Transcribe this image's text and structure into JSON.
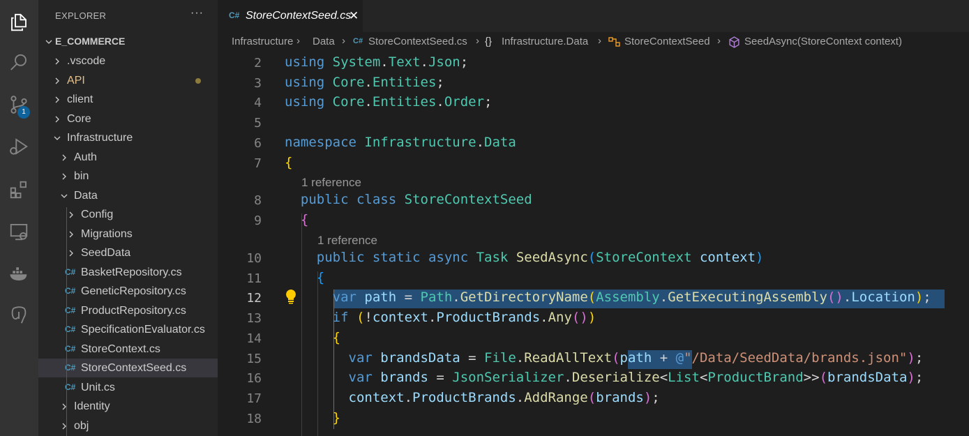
{
  "activity_bar": {
    "icons": [
      "explorer-icon",
      "search-icon",
      "source-control-icon",
      "run-debug-icon",
      "extensions-icon",
      "remote-explorer-icon",
      "docker-icon",
      "postgres-icon"
    ],
    "source_control_badge": "1"
  },
  "sidebar": {
    "title": "EXPLORER",
    "more": "···",
    "root": "E_COMMERCE",
    "items": [
      {
        "label": ".vscode"
      },
      {
        "label": "API"
      },
      {
        "label": "client"
      },
      {
        "label": "Core"
      },
      {
        "label": "Infrastructure"
      },
      {
        "label": "Auth"
      },
      {
        "label": "bin"
      },
      {
        "label": "Data"
      },
      {
        "label": "Config"
      },
      {
        "label": "Migrations"
      },
      {
        "label": "SeedData"
      },
      {
        "label": "BasketRepository.cs"
      },
      {
        "label": "GeneticRepository.cs"
      },
      {
        "label": "ProductRepository.cs"
      },
      {
        "label": "SpecificationEvaluator.cs"
      },
      {
        "label": "StoreContext.cs"
      },
      {
        "label": "StoreContextSeed.cs"
      },
      {
        "label": "Unit.cs"
      },
      {
        "label": "Identity"
      },
      {
        "label": "obj"
      }
    ],
    "cs_glyph": "C#"
  },
  "tab": {
    "label": "StoreContextSeed.cs",
    "close": "✕"
  },
  "breadcrumb": {
    "parts": [
      "Infrastructure",
      "Data",
      "StoreContextSeed.cs",
      "Infrastructure.Data",
      "StoreContextSeed",
      "SeedAsync(StoreContext context)"
    ],
    "braces": "{}"
  },
  "editor": {
    "line_numbers": [
      "2",
      "3",
      "4",
      "5",
      "6",
      "7",
      "8",
      "9",
      "10",
      "11",
      "12",
      "13",
      "14",
      "15",
      "16",
      "17",
      "18"
    ],
    "references": [
      "1 reference",
      "1 reference"
    ],
    "lines": [
      [
        [
          "using",
          "k"
        ],
        [
          " ",
          ""
        ],
        [
          "System",
          "t"
        ],
        [
          ".",
          ""
        ],
        [
          "Text",
          "t"
        ],
        [
          ".",
          ""
        ],
        [
          "Json",
          "t"
        ],
        [
          ";",
          ""
        ]
      ],
      [
        [
          "using",
          "k"
        ],
        [
          " ",
          ""
        ],
        [
          "Core",
          "t"
        ],
        [
          ".",
          ""
        ],
        [
          "Entities",
          "t"
        ],
        [
          ";",
          ""
        ]
      ],
      [
        [
          "using",
          "k"
        ],
        [
          " ",
          ""
        ],
        [
          "Core",
          "t"
        ],
        [
          ".",
          ""
        ],
        [
          "Entities",
          "t"
        ],
        [
          ".",
          ""
        ],
        [
          "Order",
          "t"
        ],
        [
          ";",
          ""
        ]
      ],
      [],
      [
        [
          "namespace",
          "k"
        ],
        [
          " ",
          ""
        ],
        [
          "Infrastructure",
          "t"
        ],
        [
          ".",
          ""
        ],
        [
          "Data",
          "t"
        ]
      ],
      [
        [
          "{",
          "b1"
        ]
      ],
      [
        [
          "  ",
          ""
        ],
        [
          "public",
          "k"
        ],
        [
          " ",
          ""
        ],
        [
          "class",
          "k"
        ],
        [
          " ",
          ""
        ],
        [
          "StoreContextSeed",
          "t"
        ]
      ],
      [
        [
          "  ",
          ""
        ],
        [
          "{",
          "b2"
        ]
      ],
      [
        [
          "    ",
          ""
        ],
        [
          "public",
          "k"
        ],
        [
          " ",
          ""
        ],
        [
          "static",
          "k"
        ],
        [
          " ",
          ""
        ],
        [
          "async",
          "k"
        ],
        [
          " ",
          ""
        ],
        [
          "Task",
          "t"
        ],
        [
          " ",
          ""
        ],
        [
          "SeedAsync",
          "f"
        ],
        [
          "(",
          "b3"
        ],
        [
          "StoreContext",
          "t"
        ],
        [
          " ",
          ""
        ],
        [
          "context",
          "v"
        ],
        [
          ")",
          "b3"
        ]
      ],
      [
        [
          "    ",
          ""
        ],
        [
          "{",
          "b3"
        ]
      ],
      [
        [
          "      ",
          ""
        ],
        [
          "var",
          "k"
        ],
        [
          " ",
          ""
        ],
        [
          "path",
          "v"
        ],
        [
          " = ",
          ""
        ],
        [
          "Path",
          "t"
        ],
        [
          ".",
          ""
        ],
        [
          "GetDirectoryName",
          "f"
        ],
        [
          "(",
          "b1"
        ],
        [
          "Assembly",
          "t"
        ],
        [
          ".",
          ""
        ],
        [
          "GetExecutingAssembly",
          "f"
        ],
        [
          "()",
          "b2"
        ],
        [
          ".",
          ""
        ],
        [
          "Location",
          "v"
        ],
        [
          ")",
          "b1"
        ],
        [
          ";",
          ""
        ]
      ],
      [
        [
          "      ",
          ""
        ],
        [
          "if",
          "k"
        ],
        [
          " ",
          ""
        ],
        [
          "(",
          "b1"
        ],
        [
          "!",
          ""
        ],
        [
          "context",
          "v"
        ],
        [
          ".",
          ""
        ],
        [
          "ProductBrands",
          "v"
        ],
        [
          ".",
          ""
        ],
        [
          "Any",
          "f"
        ],
        [
          "()",
          "b2"
        ],
        [
          ")",
          "b1"
        ]
      ],
      [
        [
          "      ",
          ""
        ],
        [
          "{",
          "b1"
        ]
      ],
      [
        [
          "        ",
          ""
        ],
        [
          "var",
          "k"
        ],
        [
          " ",
          ""
        ],
        [
          "brandsData",
          "v"
        ],
        [
          " = ",
          ""
        ],
        [
          "File",
          "t"
        ],
        [
          ".",
          ""
        ],
        [
          "ReadAllText",
          "f"
        ],
        [
          "(",
          "b2"
        ],
        [
          "path",
          "v"
        ],
        [
          " + ",
          ""
        ],
        [
          "@",
          "k"
        ],
        [
          "\"/Data/SeedData/brands.json\"",
          "s"
        ],
        [
          ")",
          "b2"
        ],
        [
          ";",
          ""
        ]
      ],
      [
        [
          "        ",
          ""
        ],
        [
          "var",
          "k"
        ],
        [
          " ",
          ""
        ],
        [
          "brands",
          "v"
        ],
        [
          " = ",
          ""
        ],
        [
          "JsonSerializer",
          "t"
        ],
        [
          ".",
          ""
        ],
        [
          "Deserialize",
          "f"
        ],
        [
          "<",
          ""
        ],
        [
          "List",
          "t"
        ],
        [
          "<",
          ""
        ],
        [
          "ProductBrand",
          "t"
        ],
        [
          ">>",
          ""
        ],
        [
          "(",
          "b2"
        ],
        [
          "brandsData",
          "v"
        ],
        [
          ")",
          "b2"
        ],
        [
          ";",
          ""
        ]
      ],
      [
        [
          "        ",
          ""
        ],
        [
          "context",
          "v"
        ],
        [
          ".",
          ""
        ],
        [
          "ProductBrands",
          "v"
        ],
        [
          ".",
          ""
        ],
        [
          "AddRange",
          "f"
        ],
        [
          "(",
          "b2"
        ],
        [
          "brands",
          "v"
        ],
        [
          ")",
          "b2"
        ],
        [
          ";",
          ""
        ]
      ],
      [
        [
          "      ",
          ""
        ],
        [
          "}",
          "b1"
        ]
      ]
    ]
  }
}
